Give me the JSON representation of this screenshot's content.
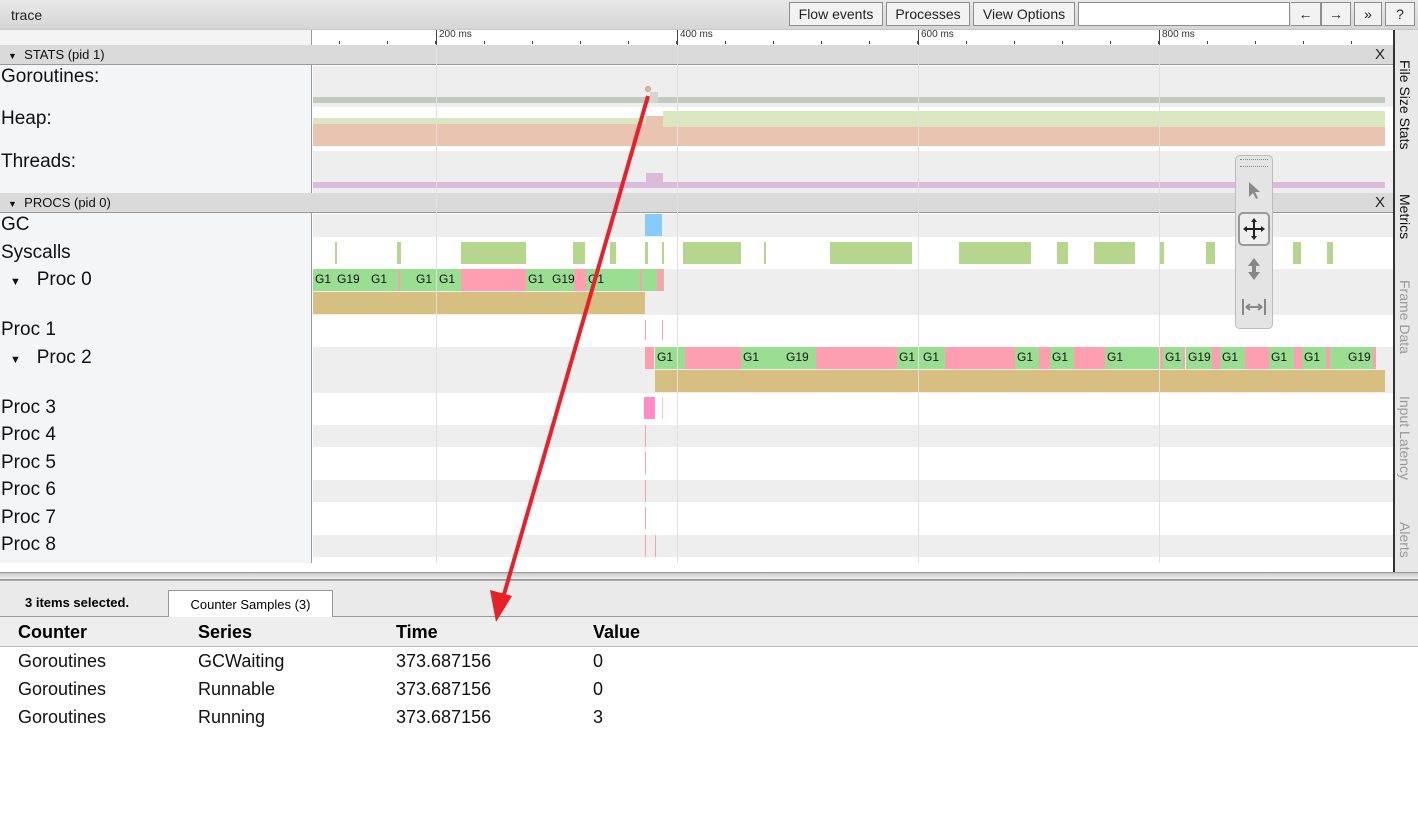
{
  "window": {
    "title": "trace"
  },
  "toolbar": {
    "flow_events": "Flow events",
    "processes": "Processes",
    "view_options": "View Options",
    "search_value": "",
    "prev": "←",
    "next": "→",
    "more": "»",
    "help": "?"
  },
  "ruler": {
    "labels": [
      "200 ms",
      "400 ms",
      "600 ms",
      "800 ms"
    ]
  },
  "stats": {
    "header": "STATS (pid 1)",
    "close": "X",
    "counters": [
      "Goroutines:",
      "Heap:",
      "Threads:"
    ]
  },
  "procs": {
    "header": "PROCS (pid 0)",
    "close": "X",
    "rows": [
      "GC",
      "Syscalls",
      "Proc 0",
      "Proc 1",
      "Proc 2",
      "Proc 3",
      "Proc 4",
      "Proc 5",
      "Proc 6",
      "Proc 7",
      "Proc 8"
    ],
    "proc0_slices": [
      "G1",
      "G19",
      "G1",
      "G1",
      "G1",
      "G1",
      "G19",
      "G1"
    ],
    "proc2_slices": [
      "G1",
      "G1",
      "G19",
      "G1",
      "G1",
      "G1",
      "G1",
      "G1",
      "G1",
      "G19",
      "G1",
      "G1",
      "G1",
      "G19"
    ]
  },
  "colors": {
    "running": "#9ade92",
    "runnable": "#ff9eb0",
    "syscall": "#b5d68c",
    "gc": "#85cbff",
    "heap_alloc": "#e9c4b0",
    "heap_next": "#d9e7c1",
    "threads": "#dbbbdc",
    "goroutines": "#c3c9bc",
    "proc_stack": "#d6bf80",
    "annotation": "#e8202a"
  },
  "tools": [
    "select-tool",
    "pan-tool",
    "zoom-tool",
    "timing-tool"
  ],
  "right_tabs": [
    "File Size Stats",
    "Metrics",
    "Frame Data",
    "Input Latency",
    "Alerts"
  ],
  "selection": {
    "summary": "3 items selected.",
    "tab": "Counter Samples (3)",
    "columns": [
      "Counter",
      "Series",
      "Time",
      "Value"
    ],
    "rows": [
      [
        "Goroutines",
        "GCWaiting",
        "373.687156",
        "0"
      ],
      [
        "Goroutines",
        "Runnable",
        "373.687156",
        "0"
      ],
      [
        "Goroutines",
        "Running",
        "373.687156",
        "3"
      ]
    ]
  }
}
